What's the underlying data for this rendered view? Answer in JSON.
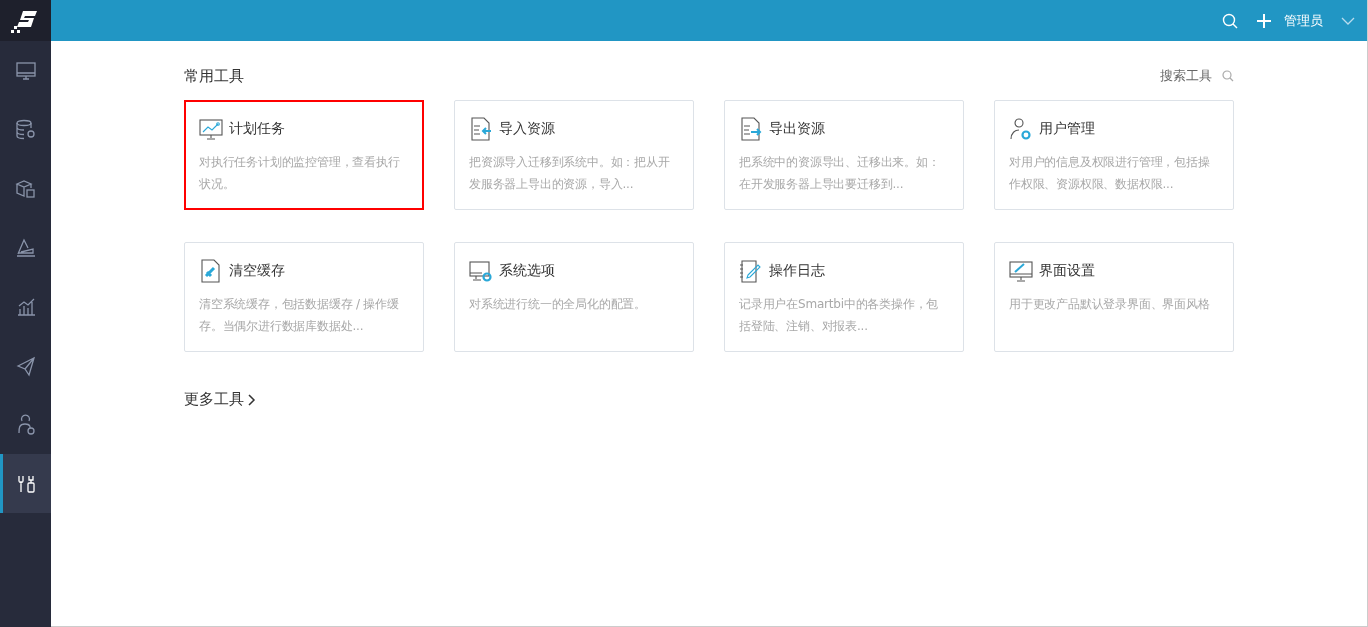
{
  "sidebar": {
    "items": [
      {
        "kind": "monitor",
        "selected": false
      },
      {
        "kind": "database",
        "selected": false
      },
      {
        "kind": "cubes",
        "selected": false
      },
      {
        "kind": "layers",
        "selected": false
      },
      {
        "kind": "chart",
        "selected": false
      },
      {
        "kind": "plane",
        "selected": false
      },
      {
        "kind": "person",
        "selected": false
      },
      {
        "kind": "tools",
        "selected": true
      }
    ]
  },
  "topbar": {
    "user": "管理员"
  },
  "section": {
    "title": "常用工具",
    "search_label": "搜索工具"
  },
  "tools": [
    {
      "kind": "schedule",
      "title": "计划任务",
      "description": "对执行任务计划的监控管理，查看执行状况。",
      "selected": true
    },
    {
      "kind": "import",
      "title": "导入资源",
      "description": "把资源导入迁移到系统中。如：把从开发服务器上导出的资源，导入...",
      "selected": false
    },
    {
      "kind": "export",
      "title": "导出资源",
      "description": "把系统中的资源导出、迁移出来。如：在开发服务器上导出要迁移到...",
      "selected": false
    },
    {
      "kind": "user",
      "title": "用户管理",
      "description": "对用户的信息及权限进行管理，包括操作权限、资源权限、数据权限...",
      "selected": false
    },
    {
      "kind": "cache",
      "title": "清空缓存",
      "description": "清空系统缓存，包括数据缓存 / 操作缓存。当偶尔进行数据库数据处...",
      "selected": false
    },
    {
      "kind": "options",
      "title": "系统选项",
      "description": "对系统进行统一的全局化的配置。",
      "selected": false
    },
    {
      "kind": "log",
      "title": "操作日志",
      "description": "记录用户在Smartbi中的各类操作，包括登陆、注销、对报表...",
      "selected": false
    },
    {
      "kind": "ui",
      "title": "界面设置",
      "description": "用于更改产品默认登录界面、界面风格",
      "selected": false
    }
  ],
  "more_link": "更多工具"
}
